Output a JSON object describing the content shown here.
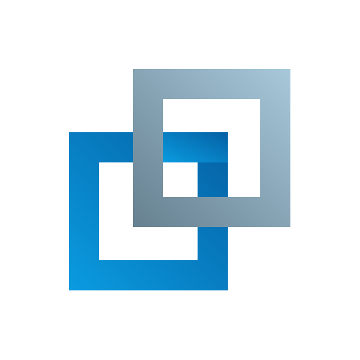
{
  "logo": {
    "icon": "interlocked-squares-logo-icon",
    "blue_square": {
      "gradient_start": "#0a9be0",
      "gradient_end": "#0560a3"
    },
    "gray_square": {
      "gradient_start": "#66808f",
      "gradient_end": "#a8c9db"
    },
    "background": "#ffffff"
  }
}
